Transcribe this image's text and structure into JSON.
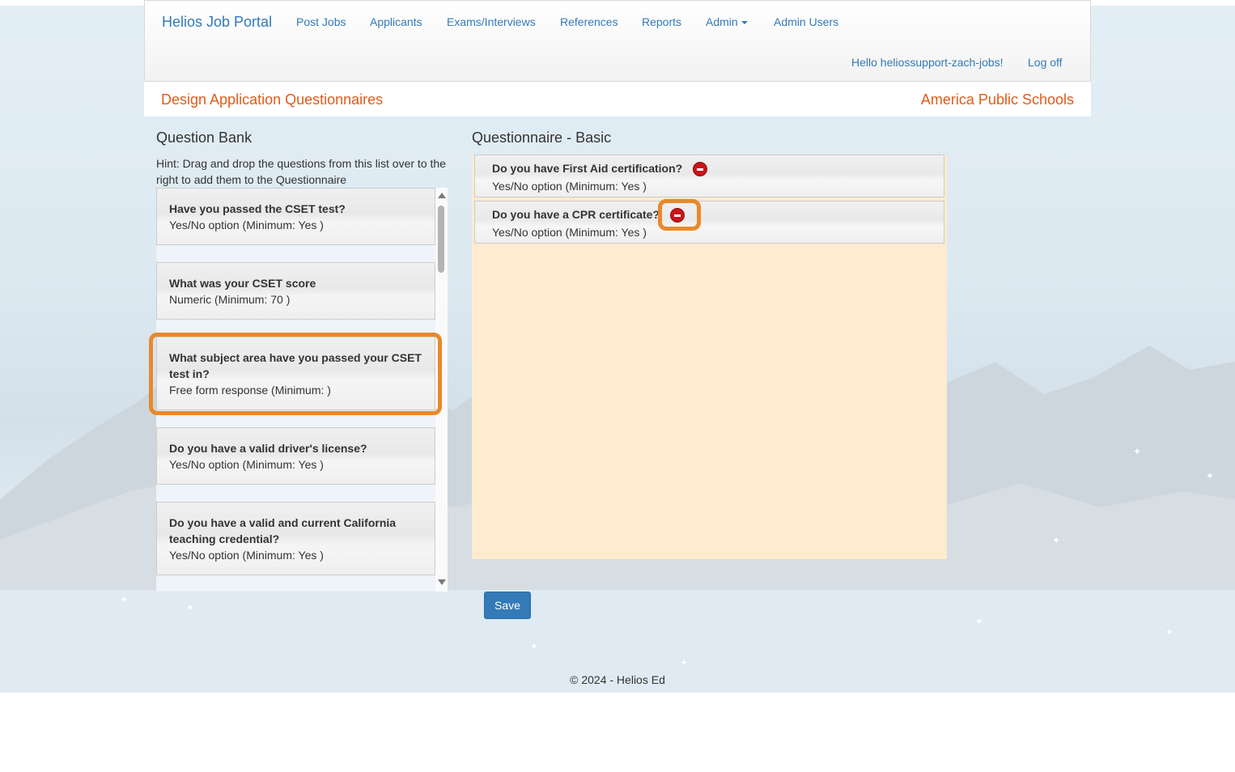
{
  "navbar": {
    "brand": "Helios Job Portal",
    "links": [
      "Post Jobs",
      "Applicants",
      "Exams/Interviews",
      "References",
      "Reports",
      "Admin",
      "Admin Users"
    ],
    "greeting": "Hello heliossupport-zach-jobs!",
    "logoff": "Log off"
  },
  "subheader": {
    "title": "Design Application Questionnaires",
    "org": "America Public Schools"
  },
  "bank": {
    "title": "Question Bank",
    "hint": "Hint: Drag and drop the questions from this list over to the right to add them to the Questionnaire",
    "items": [
      {
        "title": "Have you passed the CSET test?",
        "detail": "Yes/No option   (Minimum:  Yes )"
      },
      {
        "title": "What was your CSET score",
        "detail": "Numeric   (Minimum:  70 )"
      },
      {
        "title": "What subject area have you passed your CSET test in?",
        "detail": "Free form response   (Minimum:  )"
      },
      {
        "title": "Do you have a valid driver's license?",
        "detail": "Yes/No option   (Minimum:  Yes )"
      },
      {
        "title": "Do you have a valid and current California teaching credential?",
        "detail": "Yes/No option   (Minimum:  Yes )"
      }
    ]
  },
  "questionnaire": {
    "title": "Questionnaire - Basic",
    "items": [
      {
        "title": "Do you have First Aid certification?",
        "detail": "Yes/No option   (Minimum:  Yes )"
      },
      {
        "title": "Do you have a CPR certificate?",
        "detail": "Yes/No option   (Minimum:  Yes )"
      }
    ]
  },
  "save_label": "Save",
  "footer": "© 2024 - Helios Ed",
  "colors": {
    "accent": "#337ab7",
    "heading_orange": "#e35b19",
    "highlight": "#e8892c",
    "dropzone": "#feebd0",
    "remove": "#c8151a"
  }
}
